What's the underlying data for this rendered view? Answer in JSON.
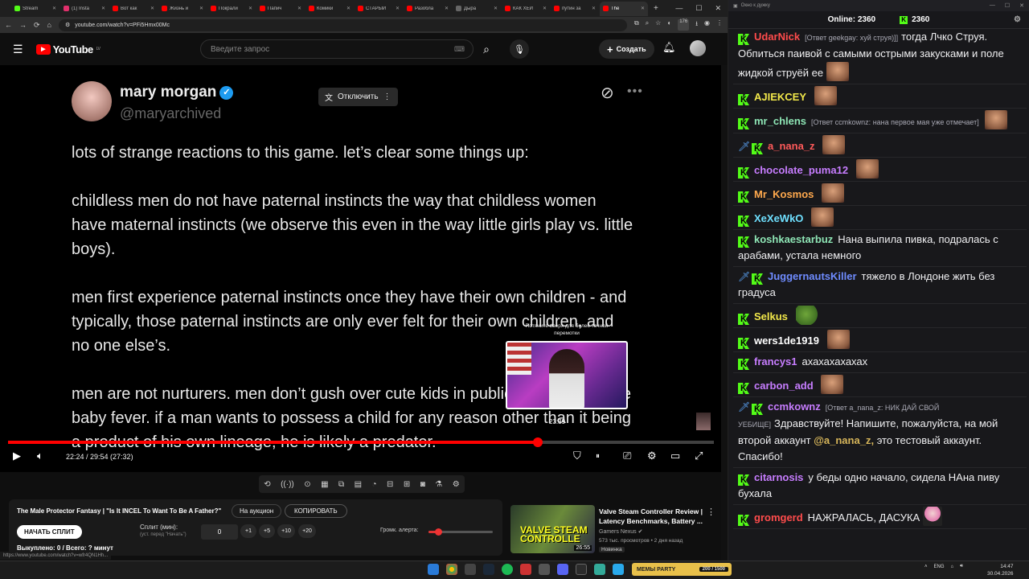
{
  "browser": {
    "tabs": [
      {
        "label": "Stream",
        "color": "#53fc18",
        "active": false
      },
      {
        "label": "(1) Insta",
        "color": "#e1306c",
        "active": false
      },
      {
        "label": "Вот как",
        "color": "#f00",
        "active": false
      },
      {
        "label": "Жизнь и",
        "color": "#f00",
        "active": false
      },
      {
        "label": "Покрали",
        "color": "#f00",
        "active": false
      },
      {
        "label": "Папич",
        "color": "#f00",
        "active": false
      },
      {
        "label": "Комики",
        "color": "#f00",
        "active": false
      },
      {
        "label": "СТАРЫЙ",
        "color": "#f00",
        "active": false
      },
      {
        "label": "Разобла",
        "color": "#f00",
        "active": false
      },
      {
        "label": "Дыра",
        "color": "#666",
        "active": false
      },
      {
        "label": "КАК ХЕЙ",
        "color": "#f00",
        "active": false
      },
      {
        "label": "путин за",
        "color": "#f00",
        "active": false
      },
      {
        "label": "The",
        "color": "#f00",
        "active": true
      }
    ],
    "new_tab": "+",
    "url": "youtube.com/watch?v=PFi5Hmx00Mc",
    "ext_badge": "176",
    "status_url": "https://www.youtube.com/watch?v=wfr4QN1Hh...",
    "window_buttons": {
      "minimize": "—",
      "maximize": "☐",
      "close": "✕"
    }
  },
  "youtube": {
    "logo_text": "YouTube",
    "region": "LV",
    "search_placeholder": "Введите запрос",
    "create_label": "Создать"
  },
  "tweet": {
    "name": "mary morgan",
    "handle": "@maryarchived",
    "translate_label": "Отключить",
    "paragraphs": [
      "lots of strange reactions to this game. let’s clear some things up:",
      "childless men do not have paternal instincts the way that childless women have maternal instincts (we observe this even in the way little girls play vs. little boys).",
      "men first experience paternal instincts once they have their own children - and typically, those paternal instincts are only ever felt for their own children, and no one else’s.",
      "men are not nurturers. men don’t gush over cute kids in public. men don’t have baby fever. if a man wants to possess a child for any reason other than it being a product of his own lineage, he is likely a predator."
    ]
  },
  "player": {
    "hover_tip": "Потяните вверх для более точной перемотки",
    "preview_time": "23:39",
    "current_time": "22:24 / 29:54 (27:32)",
    "progress": 0.75,
    "preview_center": 0.805
  },
  "split_panel": {
    "video_title": "The Male Protector Fantasy | \"Is It INCEL To Want To Be A Father?\"",
    "auction_label": "На аукцион",
    "copy_label": "КОПИРОВАТЬ",
    "start_label": "НАЧАТЬ СПЛИТ",
    "split_label": "Сплит (мин):",
    "split_sub": "(уст. перед \"Начать\")",
    "split_value": "0",
    "steps": [
      "+1",
      "+5",
      "+10",
      "+20"
    ],
    "alert_label": "Громк. алерта:",
    "alert_volume": 0.15,
    "spent": "Выкуплено: 0 / Всего: ? минут"
  },
  "recommendation": {
    "title": "Valve Steam Controller Review | Latency Benchmarks, Battery ...",
    "channel": "Gamers Nexus",
    "meta": "573 тыс. просмотров • 2 дня назад",
    "badge": "Новинка",
    "duration": "26:55",
    "thumb_text": "VALVE STEAM CONTROLLE"
  },
  "chat": {
    "window_title": "Окно к дужку",
    "online_label": "Online:",
    "online_count": "2360",
    "viewer_count": "2360",
    "messages": [
      {
        "user": "UdarNick",
        "color": "#ff4c4c",
        "reply": "[Ответ geekgay: хуй струя)]]",
        "text": "тогда Лчко Струя. Обпиться паивой с самыми острыми закусками и поле жидкой струёй ее",
        "emote": "face",
        "sword": false
      },
      {
        "user": "AJIEKCEY",
        "color": "#f2e84a",
        "reply": "",
        "text": "",
        "emote": "face",
        "sword": false
      },
      {
        "user": "mr_chlens",
        "color": "#8ee5b5",
        "reply": "[Ответ ccmkownz: нана первое мая уже отмечает]",
        "text": "",
        "emote": "face",
        "sword": false
      },
      {
        "user": "a_nana_z",
        "color": "#ff5a5a",
        "reply": "",
        "text": "",
        "emote": "face",
        "sword": true
      },
      {
        "user": "chocolate_puma12",
        "color": "#c77dff",
        "reply": "",
        "text": "",
        "emote": "face",
        "sword": false
      },
      {
        "user": "Mr_Kosmos",
        "color": "#ffa94d",
        "reply": "",
        "text": "",
        "emote": "face",
        "sword": false
      },
      {
        "user": "XeXeWkO",
        "color": "#6fe0ff",
        "reply": "",
        "text": "",
        "emote": "face",
        "sword": false
      },
      {
        "user": "koshkaestarbuz",
        "color": "#8ee5b5",
        "reply": "",
        "text": "Нана выпила пивка, подралась с арабами, устала немного",
        "emote": "",
        "sword": false
      },
      {
        "user": "JuggernautsKiller",
        "color": "#6f8cff",
        "reply": "",
        "text": "тяжело в Лондоне жить без градуса",
        "emote": "",
        "sword": true
      },
      {
        "user": "Selkus",
        "color": "#f2e84a",
        "reply": "",
        "text": "",
        "emote": "pepe",
        "sword": false
      },
      {
        "user": "wers1de1919",
        "color": "#ffffff",
        "reply": "",
        "text": "",
        "emote": "face",
        "sword": false
      },
      {
        "user": "francys1",
        "color": "#c77dff",
        "reply": "",
        "text": "ахахахахахах",
        "emote": "",
        "sword": false
      },
      {
        "user": "carbon_add",
        "color": "#c77dff",
        "reply": "",
        "text": "",
        "emote": "face",
        "sword": false
      },
      {
        "user": "ccmkownz",
        "color": "#c77dff",
        "reply": "[Ответ a_nana_z: НИК ДАЙ СВОЙ УЕБИЩЕ]",
        "text": "Здравствуйте! Напишите, пожалуйста, на мой второй аккаунт",
        "mention": "@a_nana_z,",
        "text2": "это тестовый аккаунт. Спасибо!",
        "emote": "",
        "sword": true
      },
      {
        "user": "citarnosis",
        "color": "#c77dff",
        "reply": "",
        "text": "у беды одно начало, сидела НАна пиву бухала",
        "emote": "",
        "sword": false
      },
      {
        "user": "gromgerd",
        "color": "#ff4c4c",
        "reply": "",
        "text": "НАЖРАЛАСЬ, ДАСУКА",
        "emote": "fancy",
        "sword": false
      }
    ]
  },
  "taskbar": {
    "mems_label": "МЕМЫ PARTY",
    "mems_count": "200 / 1500",
    "lang": "ENG",
    "time": "14:47",
    "date": "30.04.2026"
  }
}
